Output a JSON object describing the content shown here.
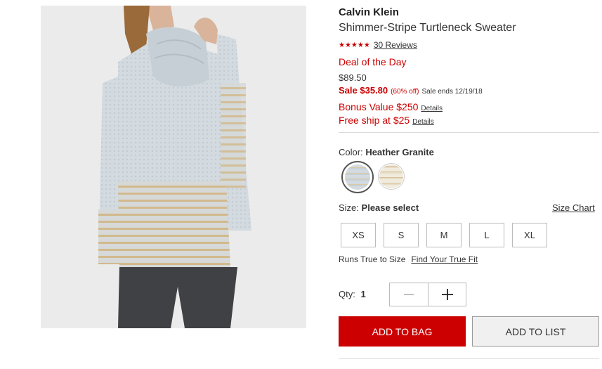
{
  "product": {
    "brand": "Calvin Klein",
    "title": "Shimmer-Stripe Turtleneck Sweater",
    "image_icon": "product-photo",
    "rating": {
      "stars_filled": 5,
      "reviews_label": "30 Reviews"
    },
    "deal_label": "Deal of the Day",
    "price": "$89.50",
    "sale": {
      "label": "Sale $35.80",
      "percent_off": "(60% off)",
      "ends": "Sale ends 12/19/18"
    },
    "bonus": {
      "label": "Bonus Value $250",
      "details": "Details"
    },
    "shipping": {
      "label": "Free ship at $25",
      "details": "Details"
    }
  },
  "color": {
    "label": "Color:",
    "selected_name": "Heather Granite",
    "swatches": [
      {
        "name": "Heather Granite",
        "color": "#c9d3db",
        "selected": true
      },
      {
        "name": "Ivory",
        "color": "#efe6d6",
        "selected": false
      }
    ]
  },
  "size": {
    "label": "Size:",
    "value": "Please select",
    "chart_link": "Size Chart",
    "options": [
      "XS",
      "S",
      "M",
      "L",
      "XL"
    ],
    "fit_text": "Runs True to Size",
    "fit_link": "Find Your True Fit"
  },
  "quantity": {
    "label": "Qty:",
    "value": "1"
  },
  "actions": {
    "add_to_bag": "ADD TO BAG",
    "add_to_list": "ADD TO LIST"
  },
  "colors": {
    "accent": "#cc0000",
    "divider": "#d9d9d9"
  }
}
